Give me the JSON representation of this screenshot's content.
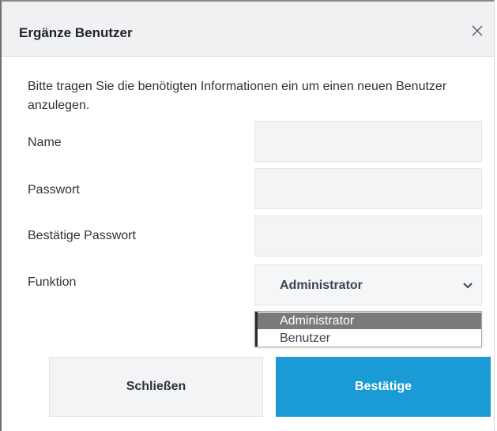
{
  "dialog": {
    "title": "Ergänze Benutzer",
    "description": "Bitte tragen Sie die benötigten Informationen ein um einen neuen Benutzer anzulegen."
  },
  "form": {
    "name_label": "Name",
    "name_value": "",
    "password_label": "Passwort",
    "password_value": "",
    "confirm_password_label": "Bestätige Passwort",
    "confirm_password_value": "",
    "role_label": "Funktion",
    "role_selected": "Administrator",
    "role_options": [
      "Administrator",
      "Benutzer"
    ]
  },
  "buttons": {
    "close_label": "Schließen",
    "confirm_label": "Bestätige"
  },
  "colors": {
    "accent": "#1a9bd6",
    "header_bg": "#f0f1f3",
    "selected_option_bg": "#7a7a7a"
  },
  "icons": {
    "close": "close-icon",
    "dropdown": "chevron-down-icon"
  }
}
